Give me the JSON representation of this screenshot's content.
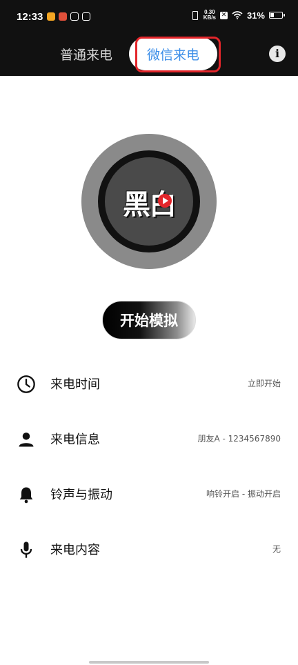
{
  "status_bar": {
    "time": "12:33",
    "net_speed_value": "0.30",
    "net_speed_unit": "KB/s",
    "battery_percent": "31%",
    "battery_level": 0.31
  },
  "tabs": {
    "normal_call": "普通来电",
    "wechat_call": "微信来电"
  },
  "info_button": "i",
  "logo": {
    "text": "黑白"
  },
  "start_button": "开始模拟",
  "settings": [
    {
      "label": "来电时间",
      "value": "立即开始",
      "icon": "clock-icon"
    },
    {
      "label": "来电信息",
      "value": "朋友A - 1234567890",
      "icon": "person-icon"
    },
    {
      "label": "铃声与振动",
      "value": "响铃开启 - 振动开启",
      "icon": "bell-icon"
    },
    {
      "label": "来电内容",
      "value": "无",
      "icon": "microphone-icon"
    }
  ],
  "colors": {
    "header_bg": "#111111",
    "active_tab_text": "#3a8de8",
    "highlight_border": "#e3262b"
  }
}
